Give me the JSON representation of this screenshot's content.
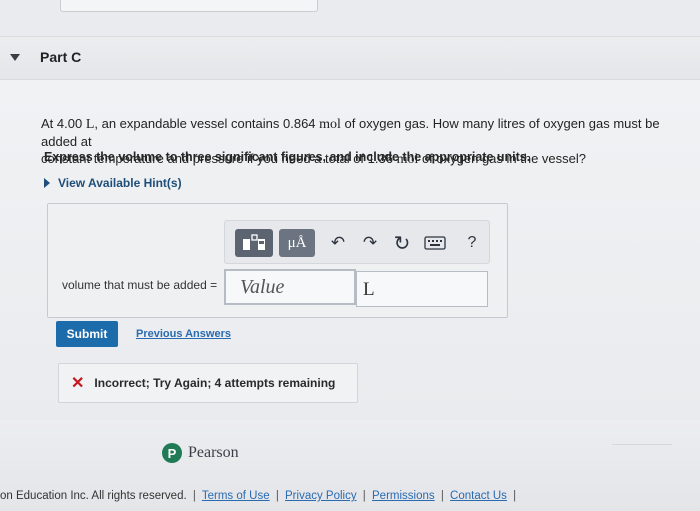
{
  "part": {
    "title": "Part C"
  },
  "question": {
    "line1_a": "At 4.00 ",
    "unit_L": "L",
    "line1_b": ", an expandable vessel contains 0.864 ",
    "unit_mol": "mol",
    "line1_c": " of oxygen gas. How many litres of oxygen gas must be added at",
    "line2_a": "constant temperature and pressure if you need a total of  1.36 ",
    "line2_c": " of oxygen gas in the vessel?"
  },
  "instructions": "Express the volume to three significant figures, and include the appropriate units.",
  "hint": {
    "label": "View Available Hint(s)"
  },
  "toolbar": {
    "units_label": "μÅ",
    "help_label": "?",
    "undo_icon": "↶",
    "redo_icon": "↷",
    "reset_icon": "↻"
  },
  "answer": {
    "label": "volume that must be added =",
    "value_placeholder": "Value",
    "unit_value": "L"
  },
  "actions": {
    "submit_label": "Submit",
    "previous_answers_label": "Previous Answers"
  },
  "feedback": {
    "icon": "✕",
    "text": "Incorrect; Try Again; 4 attempts remaining"
  },
  "brand": {
    "name": "Pearson",
    "logo_letter": "P"
  },
  "footer": {
    "copyright": "on Education Inc. All rights reserved.",
    "links": [
      "Terms of Use",
      "Privacy Policy",
      "Permissions",
      "Contact Us"
    ],
    "separator": "|"
  },
  "colors": {
    "submit": "#1c6bab",
    "link": "#2a6bb0",
    "error": "#c4161c",
    "pearson_green": "#1f7a55"
  }
}
